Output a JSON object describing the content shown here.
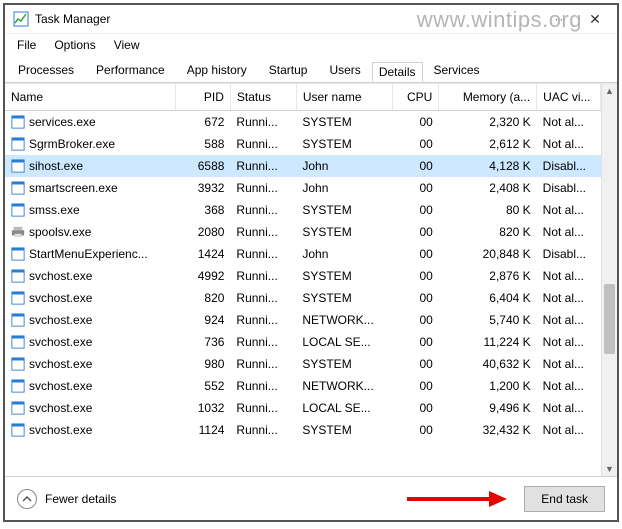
{
  "watermark": "www.wintips.org",
  "window": {
    "title": "Task Manager"
  },
  "menu": {
    "file": "File",
    "options": "Options",
    "view": "View"
  },
  "tabs": {
    "processes": "Processes",
    "performance": "Performance",
    "app_history": "App history",
    "startup": "Startup",
    "users": "Users",
    "details": "Details",
    "services": "Services"
  },
  "columns": {
    "name": "Name",
    "pid": "PID",
    "status": "Status",
    "user": "User name",
    "cpu": "CPU",
    "memory": "Memory (a...",
    "uac": "UAC vi..."
  },
  "rows": [
    {
      "icon": "app",
      "name": "services.exe",
      "pid": "672",
      "status": "Runni...",
      "user": "SYSTEM",
      "cpu": "00",
      "mem": "2,320 K",
      "uac": "Not al..."
    },
    {
      "icon": "app",
      "name": "SgrmBroker.exe",
      "pid": "588",
      "status": "Runni...",
      "user": "SYSTEM",
      "cpu": "00",
      "mem": "2,612 K",
      "uac": "Not al..."
    },
    {
      "icon": "app",
      "name": "sihost.exe",
      "pid": "6588",
      "status": "Runni...",
      "user": "John",
      "cpu": "00",
      "mem": "4,128 K",
      "uac": "Disabl...",
      "selected": true
    },
    {
      "icon": "app",
      "name": "smartscreen.exe",
      "pid": "3932",
      "status": "Runni...",
      "user": "John",
      "cpu": "00",
      "mem": "2,408 K",
      "uac": "Disabl..."
    },
    {
      "icon": "app",
      "name": "smss.exe",
      "pid": "368",
      "status": "Runni...",
      "user": "SYSTEM",
      "cpu": "00",
      "mem": "80 K",
      "uac": "Not al..."
    },
    {
      "icon": "printer",
      "name": "spoolsv.exe",
      "pid": "2080",
      "status": "Runni...",
      "user": "SYSTEM",
      "cpu": "00",
      "mem": "820 K",
      "uac": "Not al..."
    },
    {
      "icon": "app",
      "name": "StartMenuExperienc...",
      "pid": "1424",
      "status": "Runni...",
      "user": "John",
      "cpu": "00",
      "mem": "20,848 K",
      "uac": "Disabl..."
    },
    {
      "icon": "app",
      "name": "svchost.exe",
      "pid": "4992",
      "status": "Runni...",
      "user": "SYSTEM",
      "cpu": "00",
      "mem": "2,876 K",
      "uac": "Not al..."
    },
    {
      "icon": "app",
      "name": "svchost.exe",
      "pid": "820",
      "status": "Runni...",
      "user": "SYSTEM",
      "cpu": "00",
      "mem": "6,404 K",
      "uac": "Not al..."
    },
    {
      "icon": "app",
      "name": "svchost.exe",
      "pid": "924",
      "status": "Runni...",
      "user": "NETWORK...",
      "cpu": "00",
      "mem": "5,740 K",
      "uac": "Not al..."
    },
    {
      "icon": "app",
      "name": "svchost.exe",
      "pid": "736",
      "status": "Runni...",
      "user": "LOCAL SE...",
      "cpu": "00",
      "mem": "11,224 K",
      "uac": "Not al..."
    },
    {
      "icon": "app",
      "name": "svchost.exe",
      "pid": "980",
      "status": "Runni...",
      "user": "SYSTEM",
      "cpu": "00",
      "mem": "40,632 K",
      "uac": "Not al..."
    },
    {
      "icon": "app",
      "name": "svchost.exe",
      "pid": "552",
      "status": "Runni...",
      "user": "NETWORK...",
      "cpu": "00",
      "mem": "1,200 K",
      "uac": "Not al..."
    },
    {
      "icon": "app",
      "name": "svchost.exe",
      "pid": "1032",
      "status": "Runni...",
      "user": "LOCAL SE...",
      "cpu": "00",
      "mem": "9,496 K",
      "uac": "Not al..."
    },
    {
      "icon": "app",
      "name": "svchost.exe",
      "pid": "1124",
      "status": "Runni...",
      "user": "SYSTEM",
      "cpu": "00",
      "mem": "32,432 K",
      "uac": "Not al..."
    }
  ],
  "footer": {
    "fewer": "Fewer details",
    "end_task": "End task"
  }
}
